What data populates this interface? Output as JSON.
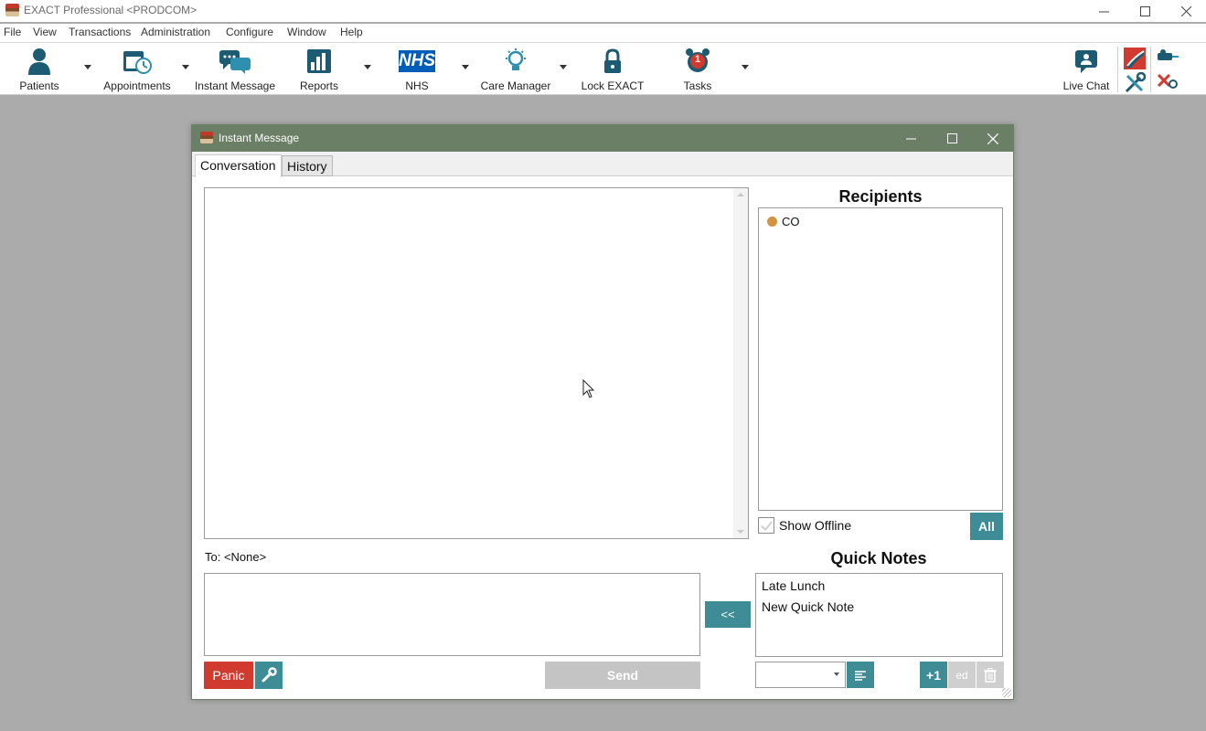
{
  "app": {
    "title": "EXACT Professional <PRODCOM>"
  },
  "menu": [
    "File",
    "View",
    "Transactions",
    "Administration",
    "Configure",
    "Window",
    "Help"
  ],
  "toolbar": {
    "patients": "Patients",
    "appointments": "Appointments",
    "instant_message": "Instant Message",
    "reports": "Reports",
    "nhs": "NHS",
    "nhs_logo_text": "NHS",
    "care_manager": "Care Manager",
    "lock": "Lock EXACT",
    "tasks": "Tasks",
    "tasks_badge": "1",
    "live_chat": "Live Chat"
  },
  "dialog": {
    "title": "Instant Message",
    "tabs": [
      "Conversation",
      "History"
    ],
    "to_label": "To: <None>",
    "panic_label": "Panic",
    "send_label": "Send",
    "insert_label": "<<",
    "recipients_heading": "Recipients",
    "recipients": [
      {
        "name": "CO",
        "status_color": "#d4933e"
      }
    ],
    "show_offline_label": "Show Offline",
    "all_label": "All",
    "quick_notes_heading": "Quick Notes",
    "quick_notes": [
      "Late Lunch",
      "New Quick Note"
    ],
    "plus_one_label": "+1",
    "edit_label": "ed"
  },
  "colors": {
    "accent": "#3e8d96",
    "dialog_title": "#6b7e66",
    "panic": "#d13a2e"
  }
}
